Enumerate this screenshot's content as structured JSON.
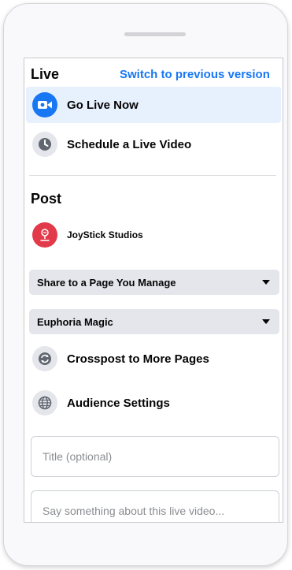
{
  "live": {
    "heading": "Live",
    "switch_link": "Switch to previous version",
    "go_live_label": "Go Live Now",
    "schedule_label": "Schedule a Live Video"
  },
  "post": {
    "heading": "Post",
    "profile_name": "JoyStick Studios",
    "share_dropdown": "Share to a Page You Manage",
    "page_dropdown": "Euphoria Magic",
    "crosspost_label": "Crosspost to More Pages",
    "audience_label": "Audience Settings",
    "title_placeholder": "Title (optional)",
    "description_placeholder": "Say something about this live video..."
  },
  "colors": {
    "accent": "#1877f2",
    "avatar_bg": "#e23a4a",
    "active_row_bg": "#e7f0fd"
  },
  "icons": {
    "go_live": "video-camera-icon",
    "schedule": "clock-icon",
    "profile": "joystick-studios-logo",
    "crosspost": "crosspost-arrows-icon",
    "audience": "globe-icon"
  }
}
